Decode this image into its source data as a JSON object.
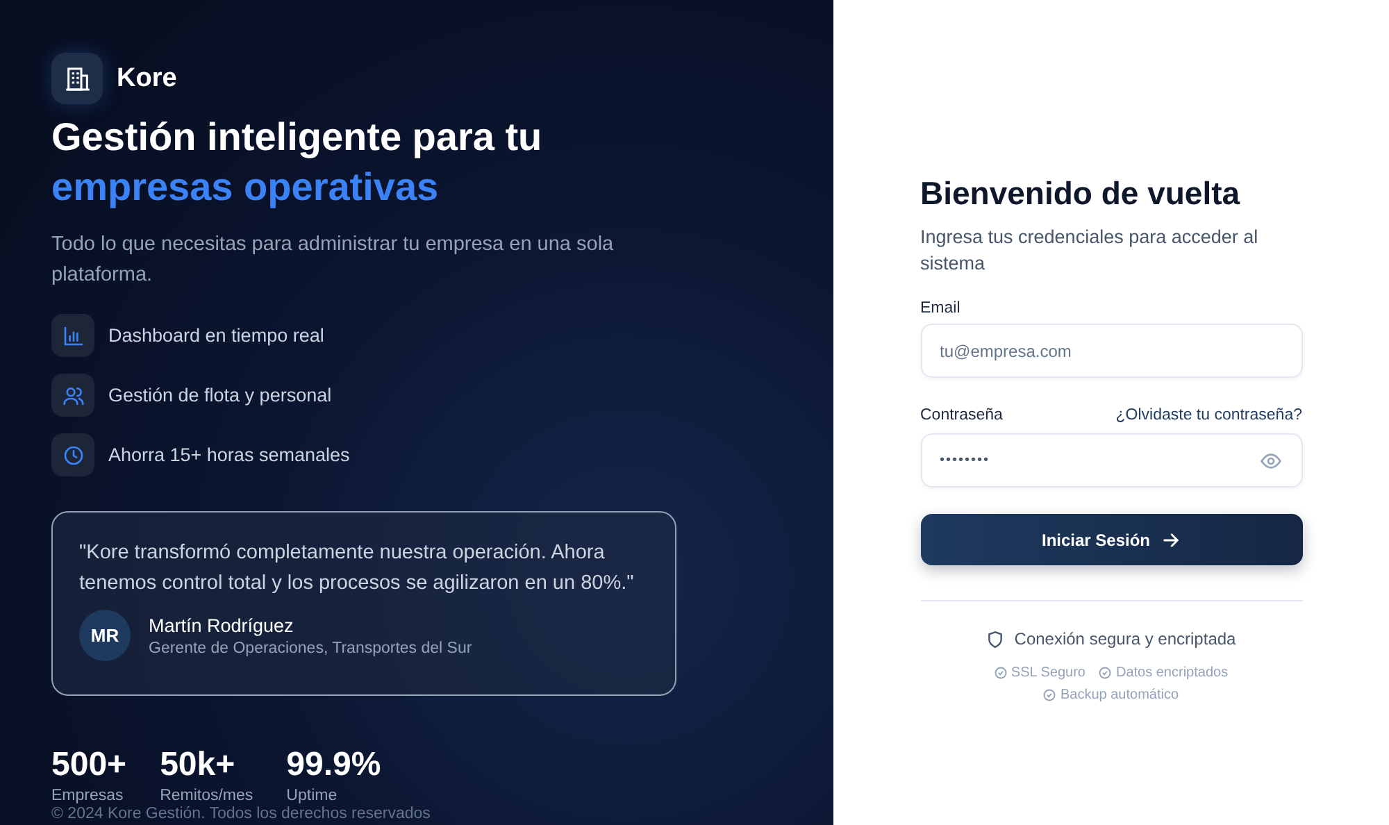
{
  "brand": {
    "name": "Kore"
  },
  "hero": {
    "title_line1": "Gestión inteligente para tu",
    "title_line2": "empresas operativas",
    "subtitle": "Todo lo que necesitas para administrar tu empresa en una sola plataforma."
  },
  "features": [
    {
      "kind": "chart",
      "label": "Dashboard en tiempo real"
    },
    {
      "kind": "users",
      "label": "Gestión de flota y personal"
    },
    {
      "kind": "clock",
      "label": "Ahorra 15+ horas semanales"
    }
  ],
  "testimonial": {
    "quote": "\"Kore transformó completamente nuestra operación. Ahora tenemos control total y los procesos se agilizaron en un 80%.\"",
    "initials": "MR",
    "name": "Martín Rodríguez",
    "role": "Gerente de Operaciones, Transportes del Sur"
  },
  "stats": [
    {
      "value": "500+",
      "label": "Empresas"
    },
    {
      "value": "50k+",
      "label": "Remitos/mes"
    },
    {
      "value": "99.9%",
      "label": "Uptime"
    }
  ],
  "footer": "© 2024 Kore Gestión. Todos los derechos reservados",
  "login": {
    "title": "Bienvenido de vuelta",
    "subtitle": "Ingresa tus credenciales para acceder al sistema",
    "email_label": "Email",
    "email_placeholder": "tu@empresa.com",
    "password_label": "Contraseña",
    "forgot_link": "¿Olvidaste tu contraseña?",
    "password_value": "••••••••",
    "submit": "Iniciar Sesión",
    "security": "Conexión segura y encriptada",
    "badges": [
      "SSL Seguro",
      "Datos encriptados",
      "Backup automático"
    ]
  }
}
